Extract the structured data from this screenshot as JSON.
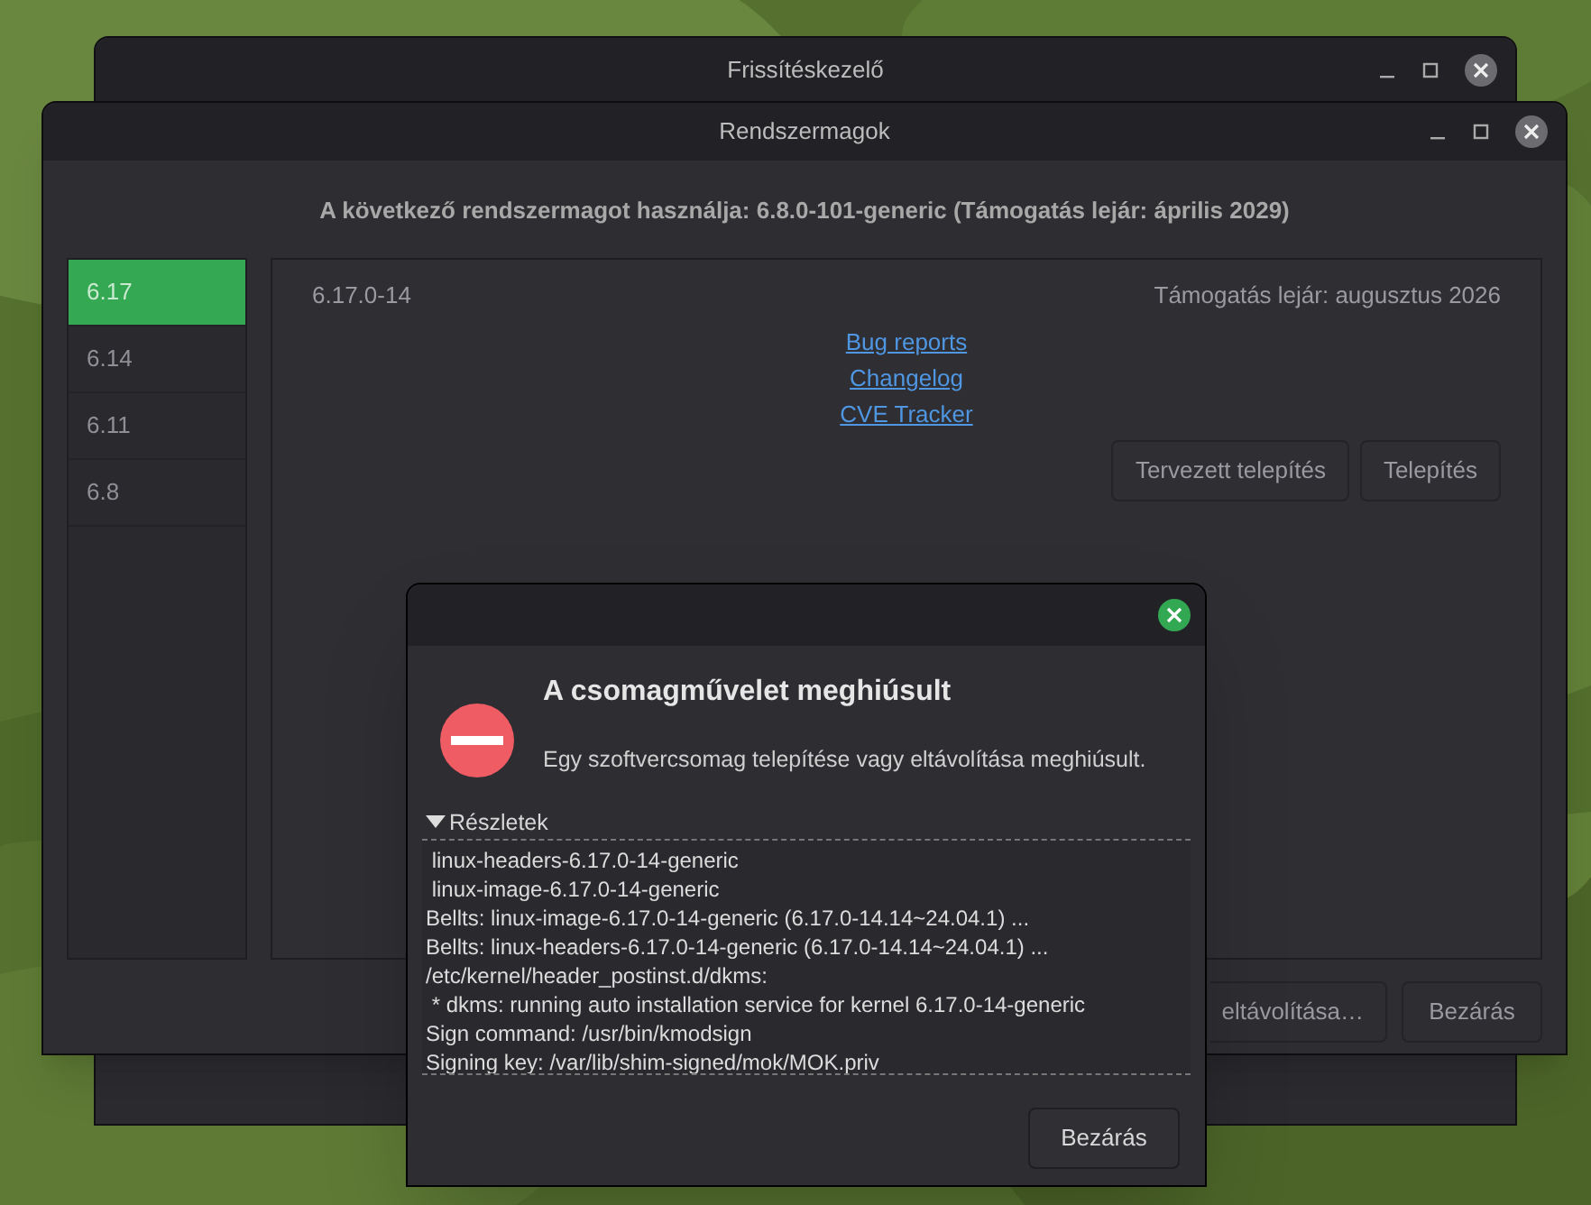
{
  "back_window": {
    "title": "Frissítéskezelő"
  },
  "kernel_window": {
    "title": "Rendszermagok",
    "heading": "A következő rendszermagot használja: 6.8.0-101-generic (Támogatás lejár: április 2029)",
    "versions": [
      {
        "label": "6.17",
        "selected": true
      },
      {
        "label": "6.14",
        "selected": false
      },
      {
        "label": "6.11",
        "selected": false
      },
      {
        "label": "6.8",
        "selected": false
      }
    ],
    "kernel": {
      "name": "6.17.0-14",
      "support": "Támogatás lejár: augusztus 2026",
      "links": [
        "Bug reports",
        "Changelog",
        "CVE Tracker"
      ],
      "buttons": [
        "Tervezett telepítés",
        "Telepítés"
      ]
    },
    "footer_buttons": [
      "eltávolítása…",
      "Bezárás"
    ]
  },
  "error_dialog": {
    "title": "A csomagművelet meghiúsult",
    "message": "Egy szoftvercsomag telepítése vagy eltávolítása meghiúsult.",
    "details": {
      "label": "Részletek",
      "expanded": true,
      "log": [
        " linux-headers-6.17.0-14-generic",
        " linux-image-6.17.0-14-generic",
        "Bellts: linux-image-6.17.0-14-generic (6.17.0-14.14~24.04.1) ...",
        "Bellts: linux-headers-6.17.0-14-generic (6.17.0-14.14~24.04.1) ...",
        "/etc/kernel/header_postinst.d/dkms:",
        " * dkms: running auto installation service for kernel 6.17.0-14-generic",
        "Sign command: /usr/bin/kmodsign",
        "Signing key: /var/lib/shim-signed/mok/MOK.priv"
      ]
    },
    "button": "Bezárás"
  }
}
